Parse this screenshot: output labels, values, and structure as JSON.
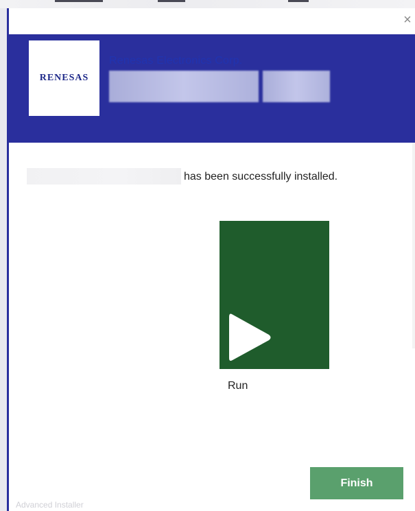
{
  "window": {
    "close_glyph": "×"
  },
  "header": {
    "logo_text": "RENESAS",
    "company_name": "Renesas Electronics Corp.",
    "accent_color": "#2a2f9d"
  },
  "content": {
    "message": "has been successfully installed.",
    "run_label": "Run",
    "run_tile_color": "#1f5c2c"
  },
  "actions": {
    "finish_label": "Finish",
    "finish_color": "#5aa06d"
  },
  "footer": {
    "text": "Advanced Installer"
  },
  "icons": {
    "close": "close-icon",
    "run": "play-icon"
  }
}
